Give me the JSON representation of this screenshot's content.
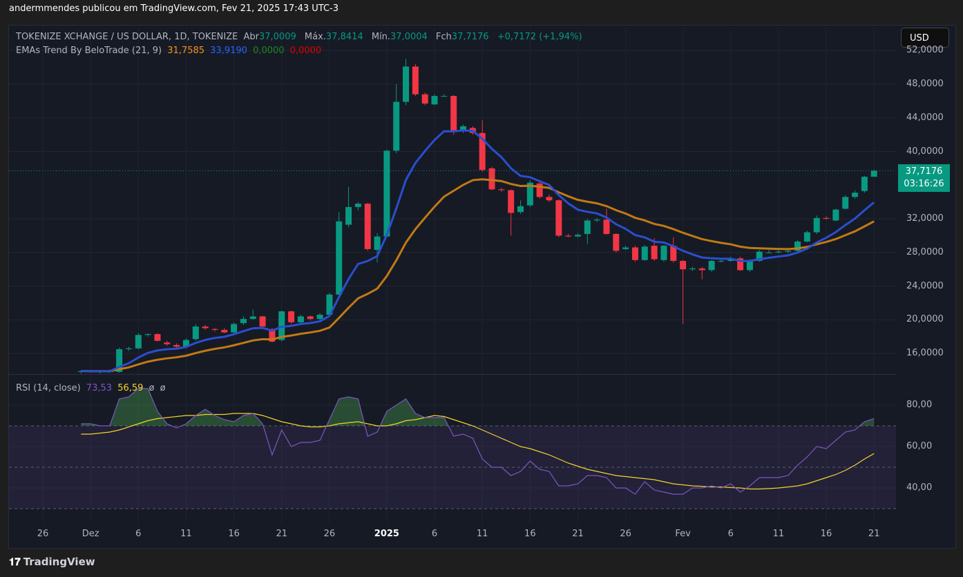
{
  "header": {
    "publish_line": "andermmendes publicou em TradingView.com, Fev 21, 2025 17:43 UTC-3"
  },
  "legend": {
    "symbol": "TOKENIZE XCHANGE / US DOLLAR, 1D, TOKENIZE",
    "open_label": "Abr",
    "open": "37,0009",
    "high_label": "Máx.",
    "high": "37,8414",
    "low_label": "Mín.",
    "low": "37,0004",
    "close_label": "Fch",
    "close": "37,7176",
    "change": "+0,7172 (+1,94%)",
    "ema_name": "EMAs Trend By BeloTrade (21, 9)",
    "ema_v1": "31,7585",
    "ema_v2": "33,9190",
    "ema_v3": "0,0000",
    "ema_v4": "0,0000",
    "rsi_name": "RSI (14, close)",
    "rsi_value": "73,53",
    "rsi_ma": "56,59",
    "rsi_x1": "ø",
    "rsi_x2": "ø"
  },
  "currency_button": "USD",
  "last_price": {
    "value": "37,7176",
    "countdown": "03:16:26"
  },
  "price_axis": [
    "52,0000",
    "48,0000",
    "44,0000",
    "40,0000",
    "32,0000",
    "28,0000",
    "24,0000",
    "20,0000",
    "16,0000"
  ],
  "rsi_axis": [
    "80,00",
    "60,00",
    "40,00"
  ],
  "date_axis": [
    {
      "t": "26",
      "d": -4
    },
    {
      "t": "Dez",
      "d": 1
    },
    {
      "t": "6",
      "d": 6
    },
    {
      "t": "11",
      "d": 11
    },
    {
      "t": "16",
      "d": 16
    },
    {
      "t": "21",
      "d": 21
    },
    {
      "t": "26",
      "d": 26
    },
    {
      "t": "2025",
      "d": 32,
      "bold": true
    },
    {
      "t": "6",
      "d": 37
    },
    {
      "t": "11",
      "d": 42
    },
    {
      "t": "16",
      "d": 47
    },
    {
      "t": "21",
      "d": 52
    },
    {
      "t": "26",
      "d": 57
    },
    {
      "t": "Fev",
      "d": 63
    },
    {
      "t": "6",
      "d": 68
    },
    {
      "t": "11",
      "d": 73
    },
    {
      "t": "16",
      "d": 78
    },
    {
      "t": "21",
      "d": 83
    }
  ],
  "brand": {
    "logo": "17",
    "name": "TradingView"
  },
  "colors": {
    "up": "#089981",
    "down": "#f23645",
    "ema_fast": "#2a4fd0",
    "ema_slow": "#c27a14",
    "rsi": "#7e57c2",
    "rsi_ma": "#f5d52b"
  },
  "chart_data": {
    "type": "candlestick",
    "start_date": "2024-11-30",
    "ohlc": [
      [
        13.8,
        14.0,
        13.6,
        13.9
      ],
      [
        13.9,
        14.0,
        13.7,
        13.8
      ],
      [
        13.8,
        14.0,
        13.6,
        13.9
      ],
      [
        13.9,
        14.1,
        13.7,
        13.8
      ],
      [
        13.8,
        16.7,
        13.7,
        16.5
      ],
      [
        16.5,
        16.8,
        16.3,
        16.6
      ],
      [
        16.6,
        18.4,
        16.5,
        18.2
      ],
      [
        18.2,
        18.4,
        18.0,
        18.3
      ],
      [
        18.3,
        18.4,
        17.4,
        17.5
      ],
      [
        17.3,
        17.5,
        16.9,
        17.1
      ],
      [
        17.0,
        17.2,
        16.6,
        16.8
      ],
      [
        16.8,
        17.8,
        16.6,
        17.6
      ],
      [
        17.7,
        19.5,
        17.5,
        19.2
      ],
      [
        19.2,
        19.4,
        18.8,
        19.0
      ],
      [
        18.9,
        19.0,
        18.6,
        18.8
      ],
      [
        18.8,
        19.0,
        18.4,
        18.5
      ],
      [
        18.5,
        19.7,
        18.3,
        19.5
      ],
      [
        19.6,
        20.4,
        19.4,
        20.1
      ],
      [
        20.1,
        21.2,
        20.0,
        20.4
      ],
      [
        20.4,
        20.5,
        19.0,
        19.2
      ],
      [
        18.9,
        19.0,
        17.3,
        17.4
      ],
      [
        17.6,
        21.1,
        17.4,
        21.0
      ],
      [
        21.0,
        21.1,
        19.5,
        19.7
      ],
      [
        19.7,
        20.6,
        19.5,
        20.4
      ],
      [
        20.4,
        20.5,
        19.9,
        20.1
      ],
      [
        20.1,
        20.8,
        19.9,
        20.6
      ],
      [
        20.6,
        23.2,
        20.4,
        23.0
      ],
      [
        23.0,
        32.8,
        22.8,
        31.7
      ],
      [
        31.3,
        35.8,
        31.0,
        33.4
      ],
      [
        33.4,
        34.0,
        33.0,
        33.8
      ],
      [
        33.8,
        33.9,
        28.2,
        28.4
      ],
      [
        28.3,
        30.3,
        26.8,
        29.9
      ],
      [
        29.9,
        40.2,
        29.8,
        40.1
      ],
      [
        40.1,
        48.0,
        39.8,
        45.9
      ],
      [
        45.9,
        51.0,
        45.5,
        50.1
      ],
      [
        50.1,
        50.4,
        46.6,
        46.8
      ],
      [
        46.8,
        47.0,
        45.5,
        45.7
      ],
      [
        45.6,
        46.8,
        45.5,
        46.6
      ],
      [
        46.6,
        46.8,
        46.5,
        46.6
      ],
      [
        46.6,
        46.7,
        42.0,
        42.3
      ],
      [
        42.5,
        43.2,
        42.2,
        43.0
      ],
      [
        42.8,
        43.0,
        42.0,
        42.2
      ],
      [
        42.2,
        43.7,
        37.6,
        37.8
      ],
      [
        38.0,
        38.2,
        35.4,
        35.5
      ],
      [
        35.5,
        35.7,
        35.2,
        35.4
      ],
      [
        35.4,
        35.5,
        30.0,
        32.7
      ],
      [
        32.8,
        34.2,
        32.6,
        33.5
      ],
      [
        33.6,
        36.6,
        33.4,
        36.3
      ],
      [
        36.2,
        36.5,
        34.4,
        34.6
      ],
      [
        34.6,
        34.9,
        34.0,
        34.2
      ],
      [
        34.2,
        34.3,
        29.8,
        30.0
      ],
      [
        30.0,
        30.2,
        29.8,
        29.9
      ],
      [
        29.9,
        30.3,
        29.8,
        30.1
      ],
      [
        30.2,
        32.0,
        29.0,
        31.8
      ],
      [
        31.8,
        32.1,
        31.6,
        31.9
      ],
      [
        31.9,
        33.2,
        30.1,
        30.2
      ],
      [
        30.2,
        30.3,
        28.0,
        28.2
      ],
      [
        28.4,
        28.8,
        28.3,
        28.6
      ],
      [
        28.6,
        28.8,
        26.9,
        27.1
      ],
      [
        27.1,
        28.9,
        27.0,
        28.7
      ],
      [
        28.8,
        29.7,
        27.0,
        27.2
      ],
      [
        27.1,
        28.9,
        26.9,
        28.8
      ],
      [
        28.8,
        29.8,
        26.8,
        27.0
      ],
      [
        27.0,
        27.1,
        19.5,
        26.0
      ],
      [
        26.0,
        26.3,
        25.8,
        26.1
      ],
      [
        26.1,
        26.3,
        24.8,
        25.9
      ],
      [
        25.9,
        27.1,
        25.7,
        27.0
      ],
      [
        27.0,
        27.2,
        26.8,
        27.0
      ],
      [
        27.0,
        27.5,
        26.9,
        27.3
      ],
      [
        27.3,
        27.5,
        25.8,
        25.9
      ],
      [
        25.9,
        27.2,
        25.7,
        27.0
      ],
      [
        27.0,
        28.3,
        26.9,
        28.1
      ],
      [
        28.0,
        28.3,
        27.9,
        28.0
      ],
      [
        28.0,
        28.5,
        27.9,
        28.1
      ],
      [
        28.1,
        28.3,
        27.9,
        28.2
      ],
      [
        28.2,
        29.5,
        28.0,
        29.3
      ],
      [
        29.3,
        30.6,
        29.2,
        30.4
      ],
      [
        30.4,
        32.4,
        30.2,
        32.1
      ],
      [
        32.1,
        32.3,
        31.9,
        32.0
      ],
      [
        31.8,
        33.2,
        31.7,
        33.1
      ],
      [
        33.2,
        34.8,
        33.1,
        34.6
      ],
      [
        34.6,
        35.4,
        34.4,
        35.1
      ],
      [
        35.3,
        37.1,
        35.1,
        37.0
      ],
      [
        37.0,
        37.84,
        37.0,
        37.72
      ]
    ],
    "ema_periods": [
      9,
      21
    ],
    "ylim": [
      12,
      52
    ],
    "rsi": [
      71,
      71,
      70,
      70,
      83,
      84,
      88,
      88,
      77,
      71,
      69,
      71,
      75,
      78,
      75,
      73,
      72,
      75,
      76,
      71,
      56,
      68,
      60,
      62,
      62,
      63,
      73,
      83,
      84,
      83,
      65,
      67,
      77,
      80,
      83,
      76,
      74,
      74,
      74,
      65,
      66,
      64,
      54,
      50,
      50,
      46,
      48,
      53,
      49,
      48,
      41,
      41,
      42,
      46,
      46,
      45,
      40,
      40,
      37,
      43,
      39,
      38,
      37,
      37,
      40,
      40,
      41,
      40,
      42,
      38,
      41,
      45,
      45,
      45,
      46,
      51,
      55,
      60,
      59,
      63,
      67,
      68,
      72,
      73.5
    ],
    "rsi_ma": [
      66,
      66,
      66.5,
      67,
      68,
      69.5,
      71,
      72.5,
      73.5,
      74,
      74.5,
      75,
      75,
      75.5,
      75.5,
      75.5,
      76,
      76,
      76,
      75,
      73.5,
      72,
      71,
      70,
      69.5,
      69.5,
      70,
      71,
      71.5,
      72,
      71,
      70,
      70,
      71,
      72.5,
      73,
      74,
      75,
      74.5,
      73,
      71.5,
      70,
      68,
      66,
      64,
      62,
      60,
      59,
      57.5,
      56,
      54,
      52,
      50.5,
      49,
      48,
      47,
      46,
      45.5,
      45,
      44.5,
      44,
      43,
      42,
      41.5,
      41,
      40.8,
      40.5,
      40.5,
      40.2,
      40,
      39.5,
      39.5,
      39.7,
      40,
      40.5,
      41,
      42,
      43.5,
      45,
      46.5,
      48.5,
      51,
      54,
      56.6
    ],
    "rsi_levels": [
      70,
      50,
      30
    ]
  }
}
